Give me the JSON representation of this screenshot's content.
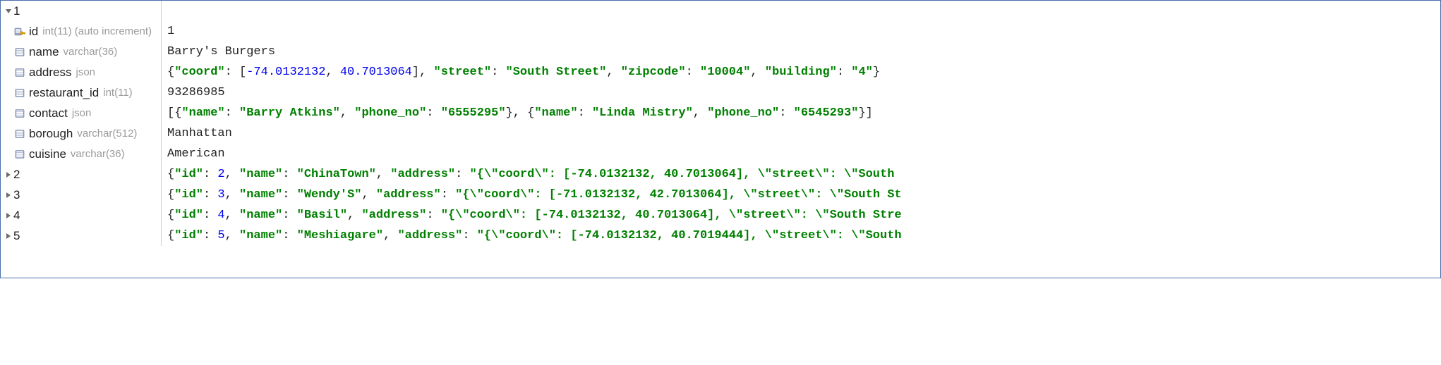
{
  "records": [
    {
      "expanded": true,
      "label": "1",
      "fields": [
        {
          "icon": "pk",
          "name": "id",
          "type": "int(11) (auto increment)",
          "value_tokens": [
            {
              "t": "plain",
              "v": "1"
            }
          ]
        },
        {
          "icon": "col",
          "name": "name",
          "type": "varchar(36)",
          "value_tokens": [
            {
              "t": "plain",
              "v": "Barry's Burgers"
            }
          ]
        },
        {
          "icon": "col",
          "name": "address",
          "type": "json",
          "value_tokens": [
            {
              "t": "p",
              "v": "{"
            },
            {
              "t": "k",
              "v": "\"coord\""
            },
            {
              "t": "p",
              "v": ": ["
            },
            {
              "t": "n",
              "v": "-74.0132132"
            },
            {
              "t": "p",
              "v": ", "
            },
            {
              "t": "n",
              "v": "40.7013064"
            },
            {
              "t": "p",
              "v": "], "
            },
            {
              "t": "k",
              "v": "\"street\""
            },
            {
              "t": "p",
              "v": ": "
            },
            {
              "t": "s",
              "v": "\"South Street\""
            },
            {
              "t": "p",
              "v": ", "
            },
            {
              "t": "k",
              "v": "\"zipcode\""
            },
            {
              "t": "p",
              "v": ": "
            },
            {
              "t": "s",
              "v": "\"10004\""
            },
            {
              "t": "p",
              "v": ", "
            },
            {
              "t": "k",
              "v": "\"building\""
            },
            {
              "t": "p",
              "v": ": "
            },
            {
              "t": "s",
              "v": "\"4\""
            },
            {
              "t": "p",
              "v": "}"
            }
          ]
        },
        {
          "icon": "col",
          "name": "restaurant_id",
          "type": "int(11)",
          "value_tokens": [
            {
              "t": "plain",
              "v": "93286985"
            }
          ]
        },
        {
          "icon": "col",
          "name": "contact",
          "type": "json",
          "value_tokens": [
            {
              "t": "p",
              "v": "[{"
            },
            {
              "t": "k",
              "v": "\"name\""
            },
            {
              "t": "p",
              "v": ": "
            },
            {
              "t": "s",
              "v": "\"Barry Atkins\""
            },
            {
              "t": "p",
              "v": ", "
            },
            {
              "t": "k",
              "v": "\"phone_no\""
            },
            {
              "t": "p",
              "v": ": "
            },
            {
              "t": "s",
              "v": "\"6555295\""
            },
            {
              "t": "p",
              "v": "}, {"
            },
            {
              "t": "k",
              "v": "\"name\""
            },
            {
              "t": "p",
              "v": ": "
            },
            {
              "t": "s",
              "v": "\"Linda Mistry\""
            },
            {
              "t": "p",
              "v": ", "
            },
            {
              "t": "k",
              "v": "\"phone_no\""
            },
            {
              "t": "p",
              "v": ": "
            },
            {
              "t": "s",
              "v": "\"6545293\""
            },
            {
              "t": "p",
              "v": "}]"
            }
          ]
        },
        {
          "icon": "col",
          "name": "borough",
          "type": "varchar(512)",
          "value_tokens": [
            {
              "t": "plain",
              "v": "Manhattan"
            }
          ]
        },
        {
          "icon": "col",
          "name": "cuisine",
          "type": "varchar(36)",
          "value_tokens": [
            {
              "t": "plain",
              "v": "American"
            }
          ]
        }
      ]
    },
    {
      "expanded": false,
      "label": "2",
      "value_tokens": [
        {
          "t": "p",
          "v": "{"
        },
        {
          "t": "k",
          "v": "\"id\""
        },
        {
          "t": "p",
          "v": ": "
        },
        {
          "t": "n",
          "v": "2"
        },
        {
          "t": "p",
          "v": ", "
        },
        {
          "t": "k",
          "v": "\"name\""
        },
        {
          "t": "p",
          "v": ": "
        },
        {
          "t": "s",
          "v": "\"ChinaTown\""
        },
        {
          "t": "p",
          "v": ", "
        },
        {
          "t": "k",
          "v": "\"address\""
        },
        {
          "t": "p",
          "v": ": "
        },
        {
          "t": "s",
          "v": "\"{\\\"coord\\\": [-74.0132132, 40.7013064], \\\"street\\\": \\\"South "
        }
      ]
    },
    {
      "expanded": false,
      "label": "3",
      "value_tokens": [
        {
          "t": "p",
          "v": "{"
        },
        {
          "t": "k",
          "v": "\"id\""
        },
        {
          "t": "p",
          "v": ": "
        },
        {
          "t": "n",
          "v": "3"
        },
        {
          "t": "p",
          "v": ", "
        },
        {
          "t": "k",
          "v": "\"name\""
        },
        {
          "t": "p",
          "v": ": "
        },
        {
          "t": "s",
          "v": "\"Wendy'S\""
        },
        {
          "t": "p",
          "v": ", "
        },
        {
          "t": "k",
          "v": "\"address\""
        },
        {
          "t": "p",
          "v": ": "
        },
        {
          "t": "s",
          "v": "\"{\\\"coord\\\": [-71.0132132, 42.7013064], \\\"street\\\": \\\"South St"
        }
      ]
    },
    {
      "expanded": false,
      "label": "4",
      "value_tokens": [
        {
          "t": "p",
          "v": "{"
        },
        {
          "t": "k",
          "v": "\"id\""
        },
        {
          "t": "p",
          "v": ": "
        },
        {
          "t": "n",
          "v": "4"
        },
        {
          "t": "p",
          "v": ", "
        },
        {
          "t": "k",
          "v": "\"name\""
        },
        {
          "t": "p",
          "v": ": "
        },
        {
          "t": "s",
          "v": "\"Basil\""
        },
        {
          "t": "p",
          "v": ", "
        },
        {
          "t": "k",
          "v": "\"address\""
        },
        {
          "t": "p",
          "v": ": "
        },
        {
          "t": "s",
          "v": "\"{\\\"coord\\\": [-74.0132132, 40.7013064], \\\"street\\\": \\\"South Stre"
        }
      ]
    },
    {
      "expanded": false,
      "label": "5",
      "value_tokens": [
        {
          "t": "p",
          "v": "{"
        },
        {
          "t": "k",
          "v": "\"id\""
        },
        {
          "t": "p",
          "v": ": "
        },
        {
          "t": "n",
          "v": "5"
        },
        {
          "t": "p",
          "v": ", "
        },
        {
          "t": "k",
          "v": "\"name\""
        },
        {
          "t": "p",
          "v": ": "
        },
        {
          "t": "s",
          "v": "\"Meshiagare\""
        },
        {
          "t": "p",
          "v": ", "
        },
        {
          "t": "k",
          "v": "\"address\""
        },
        {
          "t": "p",
          "v": ": "
        },
        {
          "t": "s",
          "v": "\"{\\\"coord\\\": [-74.0132132, 40.7019444], \\\"street\\\": \\\"South "
        }
      ]
    }
  ]
}
